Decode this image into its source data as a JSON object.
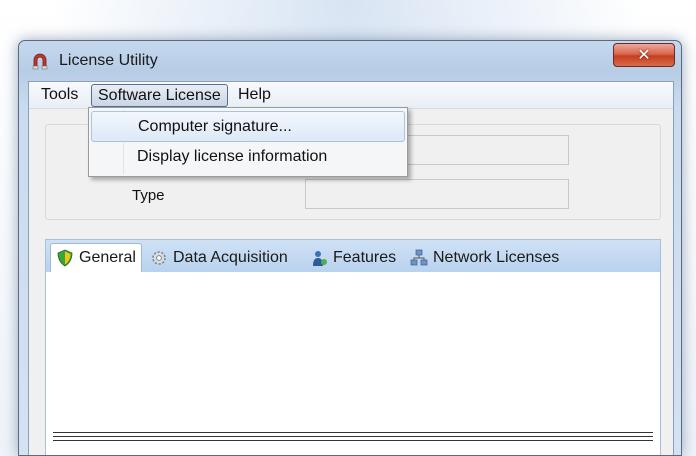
{
  "window": {
    "title": "License Utility",
    "close_glyph": "✕"
  },
  "menubar": {
    "items": [
      {
        "label": "Tools"
      },
      {
        "label": "Software License"
      },
      {
        "label": "Help"
      }
    ]
  },
  "dropdown": {
    "items": [
      {
        "label": "Computer signature..."
      },
      {
        "label": "Display license information"
      }
    ]
  },
  "license_info": {
    "type_label": "Type",
    "type_value": "",
    "top_value": ""
  },
  "tabs": [
    {
      "label": "General",
      "icon": "shield-icon"
    },
    {
      "label": "Data Acquisition",
      "icon": "gear-icon"
    },
    {
      "label": "Features",
      "icon": "person-icon"
    },
    {
      "label": "Network Licenses",
      "icon": "network-icon"
    }
  ],
  "colors": {
    "tab_strip": "#b9d2ee",
    "close_button": "#c4401f",
    "app_icon": "#c0392b"
  }
}
